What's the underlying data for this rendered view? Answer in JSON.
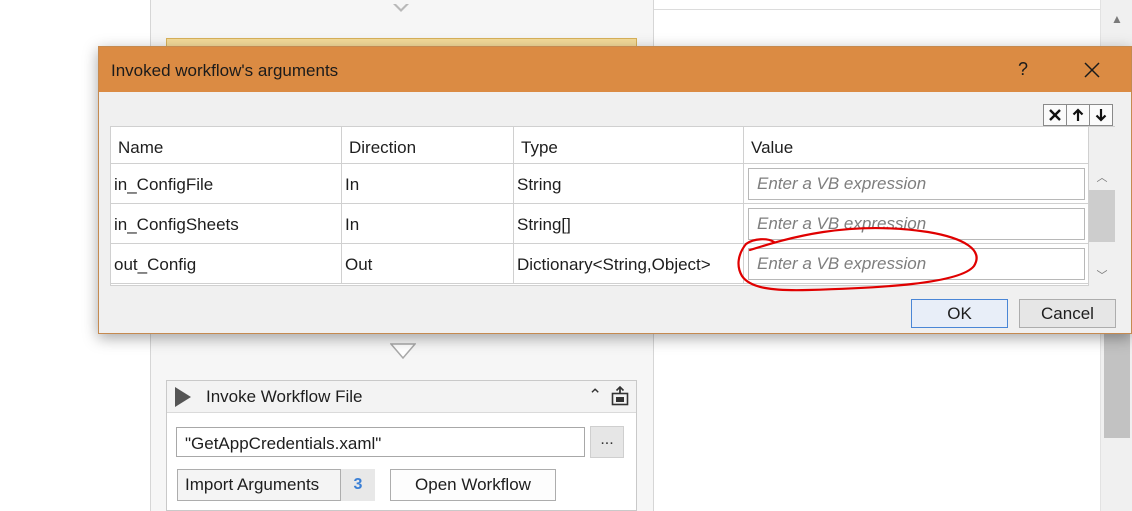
{
  "dialog": {
    "title": "Invoked workflow's arguments",
    "help_label": "?",
    "ok_label": "OK",
    "cancel_label": "Cancel",
    "toolbar": [
      {
        "icon": "delete-icon"
      },
      {
        "icon": "move-up-icon"
      },
      {
        "icon": "move-down-icon"
      }
    ],
    "columns": [
      "Name",
      "Direction",
      "Type",
      "Value"
    ],
    "rows": [
      {
        "name": "in_ConfigFile",
        "direction": "In",
        "type": "String",
        "value": "",
        "placeholder": "Enter a VB expression"
      },
      {
        "name": "in_ConfigSheets",
        "direction": "In",
        "type": "String[]",
        "value": "",
        "placeholder": "Enter a VB expression"
      },
      {
        "name": "out_Config",
        "direction": "Out",
        "type": "Dictionary<String,Object>",
        "value": "",
        "placeholder": "Enter a VB expression"
      }
    ]
  },
  "activity": {
    "title": "Invoke Workflow File",
    "file_path": "\"GetAppCredentials.xaml\"",
    "browse_label": "...",
    "import_label": "Import Arguments",
    "arg_count": "3",
    "open_label": "Open Workflow"
  },
  "colors": {
    "titlebar": "#db8b43",
    "annotation": "#e00000",
    "ok_border": "#4a86d6",
    "arg_count": "#3a7fd5"
  }
}
